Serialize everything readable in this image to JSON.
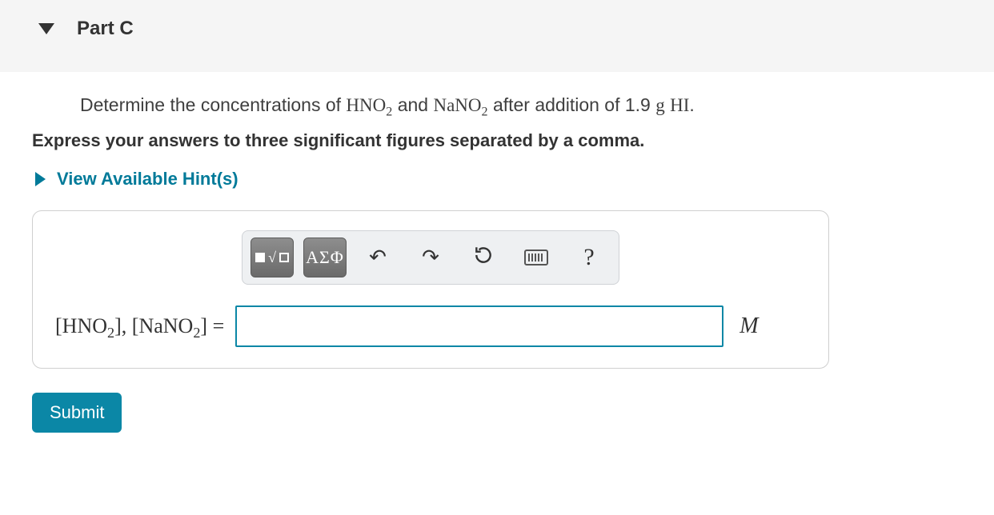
{
  "part": {
    "label": "Part C"
  },
  "question": {
    "prefix": "Determine the concentrations of ",
    "chem1_base": "HNO",
    "chem1_sub": "2",
    "and": " and ",
    "chem2_base": "NaNO",
    "chem2_sub": "2",
    "after": " after addition of 1.9 ",
    "mass_unit": "g",
    "space": " ",
    "reagent": "HI",
    "period": "."
  },
  "instruction": "Express your answers to three significant figures separated by a comma.",
  "hints": {
    "label": "View Available Hint(s)"
  },
  "toolbar": {
    "templates_title": "Templates",
    "greek_label": "ΑΣΦ",
    "help_label": "?"
  },
  "answer": {
    "lhs_open1": "[",
    "lhs_chem1_base": "HNO",
    "lhs_chem1_sub": "2",
    "lhs_close1": "]",
    "lhs_sep": ", ",
    "lhs_open2": "[",
    "lhs_chem2_base": "NaNO",
    "lhs_chem2_sub": "2",
    "lhs_close2": "]",
    "lhs_eq": " = ",
    "value": "",
    "unit": "M"
  },
  "submit": {
    "label": "Submit"
  }
}
